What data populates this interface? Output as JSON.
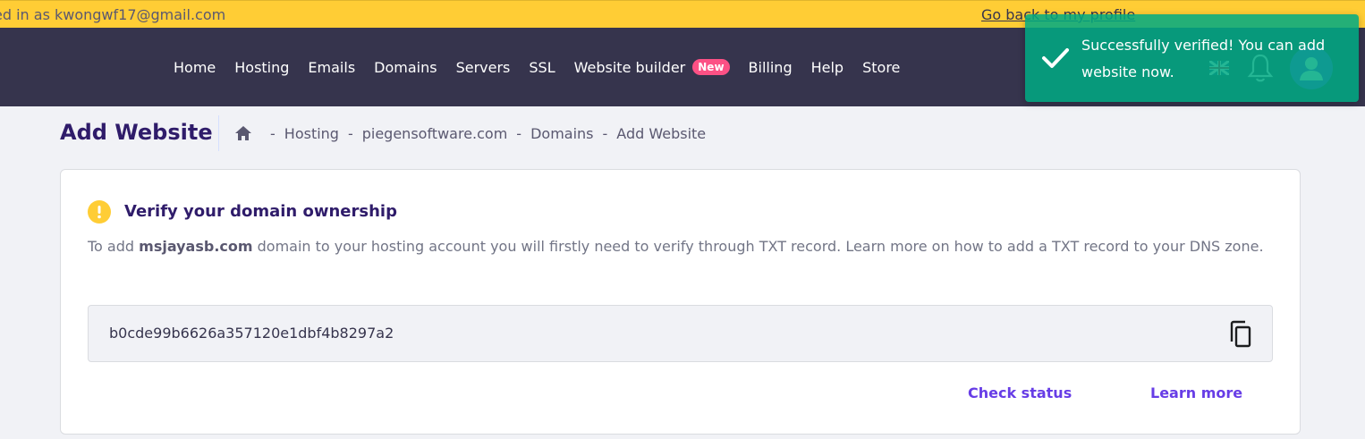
{
  "banner": {
    "logged_in_text": "ed in as kwongwf17@gmail.com",
    "go_back_link": "Go back to my profile"
  },
  "nav": {
    "items": [
      "Home",
      "Hosting",
      "Emails",
      "Domains",
      "Servers",
      "SSL",
      "Website builder",
      "Billing",
      "Help",
      "Store"
    ],
    "new_badge": "New",
    "icons": [
      "flag-icon",
      "bell-icon",
      "avatar-icon"
    ]
  },
  "toast": {
    "message": "Successfully verified! You can add website now.",
    "icon": "check-icon"
  },
  "page": {
    "title": "Add Website",
    "breadcrumb": [
      "Hosting",
      "piegensoftware.com",
      "Domains",
      "Add Website"
    ],
    "breadcrumb_separator": "-"
  },
  "card": {
    "title": "Verify your domain ownership",
    "desc_prefix": "To add ",
    "domain": "msjayasb.com",
    "desc_suffix": " domain to your hosting account you will firstly need to verify through TXT record. Learn more on how to add a TXT record to your DNS zone.",
    "txt_record": "b0cde99b6626a357120e1dbf4b8297a2",
    "check_status_label": "Check status",
    "learn_more_label": "Learn more"
  },
  "colors": {
    "banner": "#ffcd35",
    "navbar": "#36344d",
    "toast": "#00aa82",
    "accent": "#673de6",
    "badge": "#fc5185"
  }
}
